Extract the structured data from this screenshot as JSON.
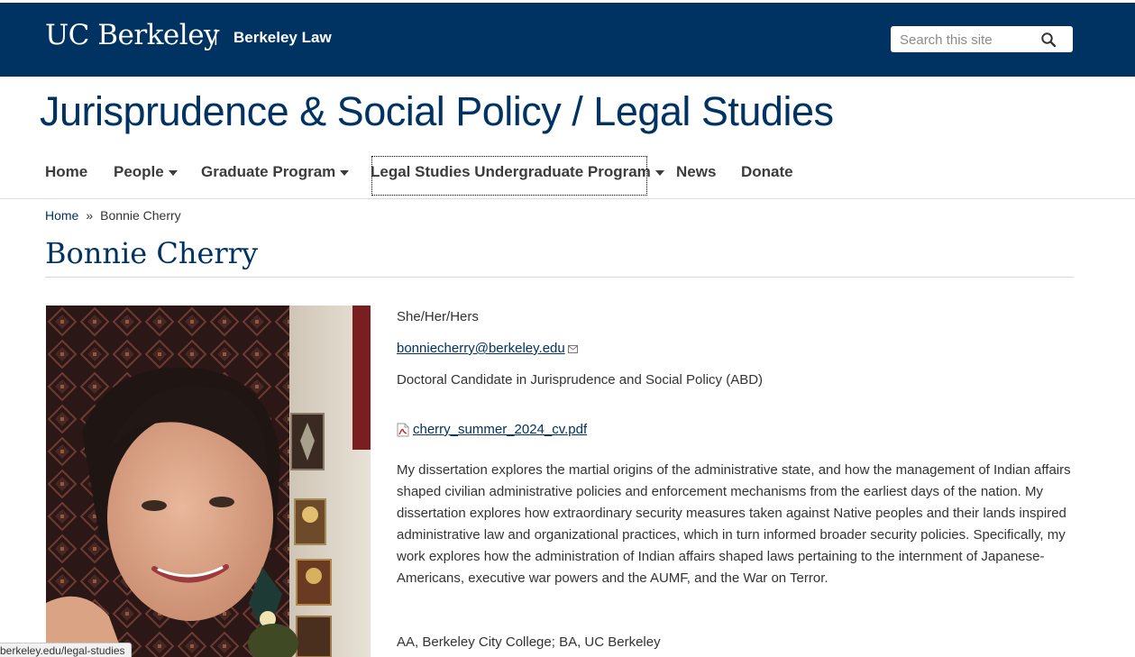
{
  "header": {
    "brand": "UC Berkeley",
    "separator": "|",
    "sub_brand": "Berkeley Law",
    "search_placeholder": "Search this site",
    "colors": {
      "primary": "#003262"
    }
  },
  "site_title": "Jurisprudence & Social Policy / Legal Studies",
  "nav": {
    "items": [
      {
        "label": "Home"
      },
      {
        "label": "People",
        "dropdown": true
      },
      {
        "label": "Graduate Program",
        "dropdown": true
      },
      {
        "label": "Legal Studies Undergraduate Program",
        "dropdown": true,
        "focused": true
      },
      {
        "label": "News"
      },
      {
        "label": "Donate"
      }
    ]
  },
  "breadcrumb": {
    "home": "Home",
    "separator": "»",
    "current": "Bonnie Cherry"
  },
  "page_title": "Bonnie Cherry",
  "profile": {
    "pronouns": "She/Her/Hers",
    "email": "bonniecherry@berkeley.edu",
    "role": "Doctoral Candidate in Jurisprudence and Social Policy (ABD)",
    "cv_file": "cherry_summer_2024_cv.pdf",
    "bio": "My dissertation explores the martial origins of the administrative state, and how the management of Indian affairs shaped civilian administrative policies and enforcement mechanisms from the earliest days of the nation. My dissertation explores how extraordinary security measures taken against Native peoples and their lands inspired administrative law and organizational practices, which in turn informed broader security policies. Specifically, my work explores how the administration of Indian affairs shaped laws pertaining to the internment of Japanese-Americans, executive war powers and the AUMF, and the War on Terror.",
    "education": "AA, Berkeley City College; BA, UC Berkeley"
  },
  "status_bar": {
    "url": "berkeley.edu/legal-studies"
  }
}
